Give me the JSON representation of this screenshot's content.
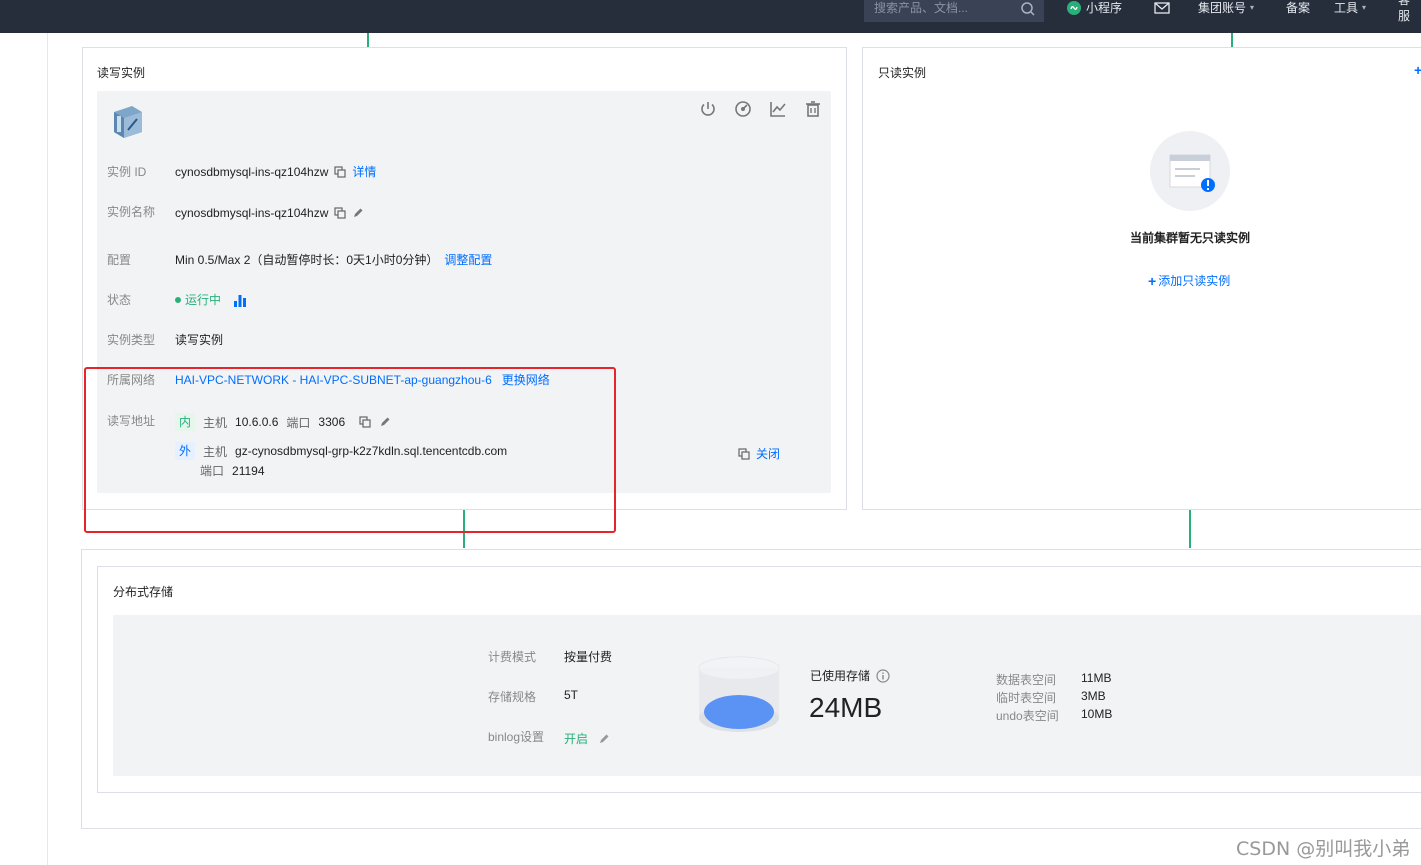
{
  "topbar": {
    "search_placeholder": "搜索产品、文档...",
    "miniprogram": "小程序",
    "group_account": "集团账号",
    "beian": "备案",
    "tools": "工具",
    "support": "客服"
  },
  "rw_instance": {
    "title": "读写实例",
    "rows": {
      "id": {
        "label": "实例 ID",
        "value": "cynosdbmysql-ins-qz104hzw",
        "link": "详情"
      },
      "name": {
        "label": "实例名称",
        "value": "cynosdbmysql-ins-qz104hzw"
      },
      "config": {
        "label": "配置",
        "value": "Min 0.5/Max 2（自动暂停时长：0天1小时0分钟）",
        "link": "调整配置"
      },
      "status": {
        "label": "状态",
        "value": "运行中"
      },
      "type": {
        "label": "实例类型",
        "value": "读写实例"
      },
      "network": {
        "label": "所属网络",
        "value": "HAI-VPC-NETWORK - HAI-VPC-SUBNET-ap-guangzhou-6",
        "link": "更换网络"
      },
      "address": {
        "label": "读写地址",
        "inner": {
          "tag": "内",
          "host_label": "主机",
          "host": "10.6.0.6",
          "port_label": "端口",
          "port": "3306"
        },
        "outer": {
          "tag": "外",
          "host_label": "主机",
          "host": "gz-cynosdbmysql-grp-k2z7kdln.sql.tencentcdb.com",
          "port_label": "端口",
          "port": "21194"
        },
        "close_label": "关闭"
      }
    }
  },
  "ro_instance": {
    "title": "只读实例",
    "empty_text": "当前集群暂无只读实例",
    "add_label": "添加只读实例"
  },
  "storage": {
    "title": "分布式存储",
    "billing_label": "计费模式",
    "billing_value": "按量付费",
    "spec_label": "存储规格",
    "spec_value": "5T",
    "binlog_label": "binlog设置",
    "binlog_value": "开启",
    "used_label": "已使用存储",
    "used_value": "24MB",
    "spaces": [
      {
        "label": "数据表空间",
        "value": "11MB"
      },
      {
        "label": "临时表空间",
        "value": "3MB"
      },
      {
        "label": "undo表空间",
        "value": "10MB"
      }
    ]
  },
  "watermark": "CSDN @别叫我小弟",
  "colors": {
    "accent": "#006eff",
    "running": "#29b079",
    "highlight": "#e6242b",
    "topbar": "#262d3b"
  }
}
